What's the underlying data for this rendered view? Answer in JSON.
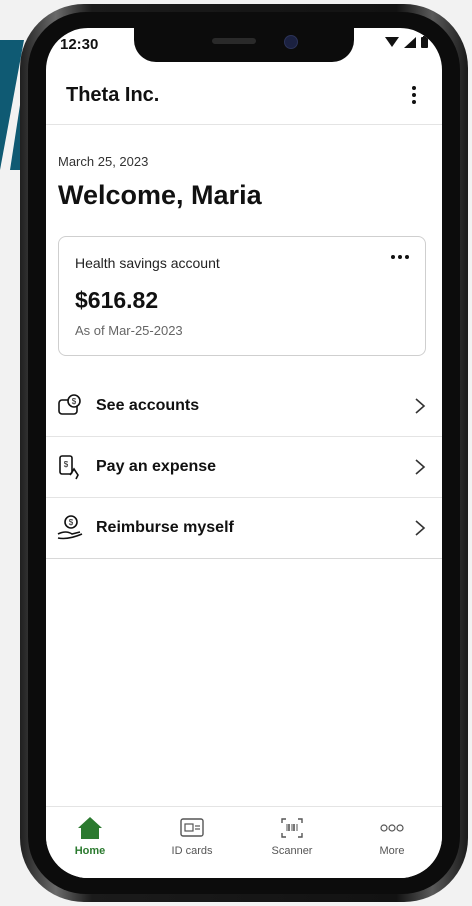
{
  "status": {
    "time": "12:30"
  },
  "header": {
    "company": "Theta Inc."
  },
  "date": "March 25, 2023",
  "welcome": "Welcome, Maria",
  "card": {
    "title": "Health savings account",
    "amount": "$616.82",
    "as_of": "As of Mar-25-2023"
  },
  "menu": [
    {
      "label": "See accounts",
      "icon": "accounts-icon"
    },
    {
      "label": "Pay an expense",
      "icon": "pay-expense-icon"
    },
    {
      "label": "Reimburse myself",
      "icon": "reimburse-icon"
    }
  ],
  "tabs": [
    {
      "label": "Home",
      "icon": "home-icon",
      "active": true
    },
    {
      "label": "ID cards",
      "icon": "id-card-icon",
      "active": false
    },
    {
      "label": "Scanner",
      "icon": "scanner-icon",
      "active": false
    },
    {
      "label": "More",
      "icon": "more-icon",
      "active": false
    }
  ],
  "colors": {
    "accent": "#2b7a2f",
    "brand_teal": "#0f5a73"
  }
}
